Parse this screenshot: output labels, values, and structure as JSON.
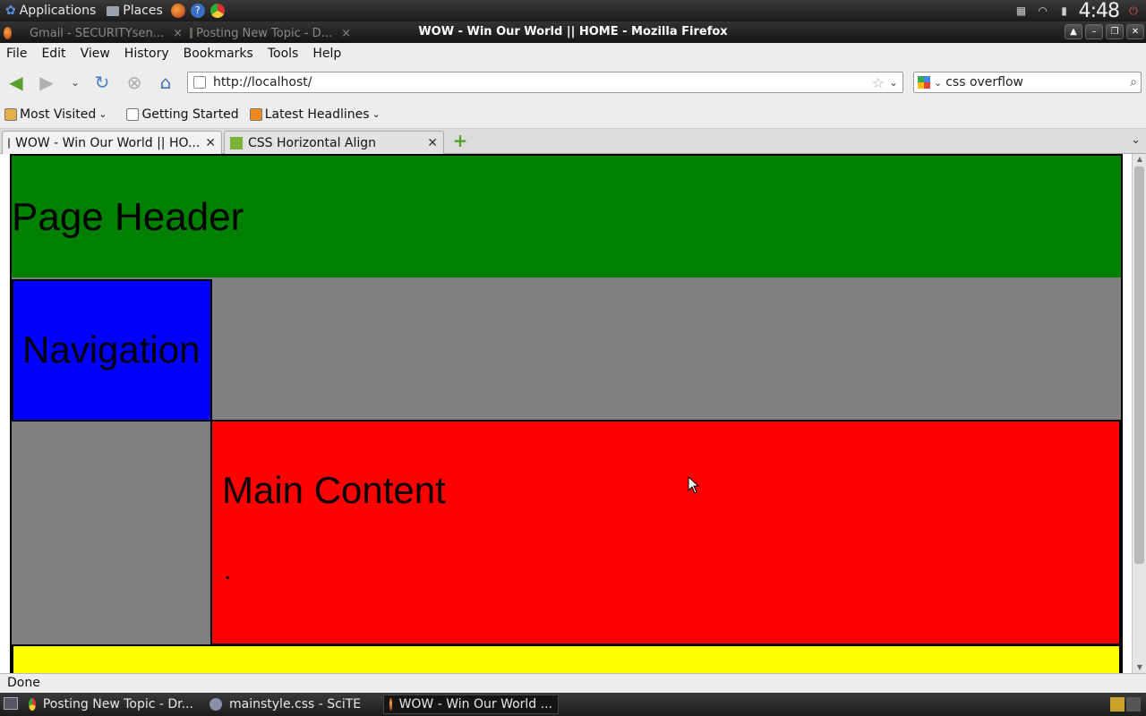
{
  "top_panel": {
    "applications": "Applications",
    "places": "Places",
    "clock": "4:48"
  },
  "titlebar": {
    "title": "WOW - Win Our World || HOME - Mozilla Firefox",
    "bg_tab_1": "Gmail - SECURITYsen...",
    "bg_tab_2": "Posting New Topic - D..."
  },
  "menubar": {
    "items": [
      "File",
      "Edit",
      "View",
      "History",
      "Bookmarks",
      "Tools",
      "Help"
    ]
  },
  "navbar": {
    "url": "http://localhost/",
    "search_value": "css overflow"
  },
  "bookmarks": {
    "items": [
      "Most Visited",
      "Getting Started",
      "Latest Headlines"
    ]
  },
  "tabs": [
    {
      "label": "WOW - Win Our World || HO..."
    },
    {
      "label": "CSS Horizontal Align"
    }
  ],
  "page": {
    "header": "Page Header",
    "navigation": "Navigation",
    "main_content": "Main Content",
    "main_dot": ".",
    "colors": {
      "header": "#008000",
      "navigation": "#0000ff",
      "body": "#808080",
      "main": "#ff0000",
      "footer": "#ffff00"
    }
  },
  "statusbar": {
    "text": "Done"
  },
  "taskbar": {
    "items": [
      "Posting New Topic - Dr...",
      "mainstyle.css - SciTE",
      "WOW - Win Our World ..."
    ]
  }
}
